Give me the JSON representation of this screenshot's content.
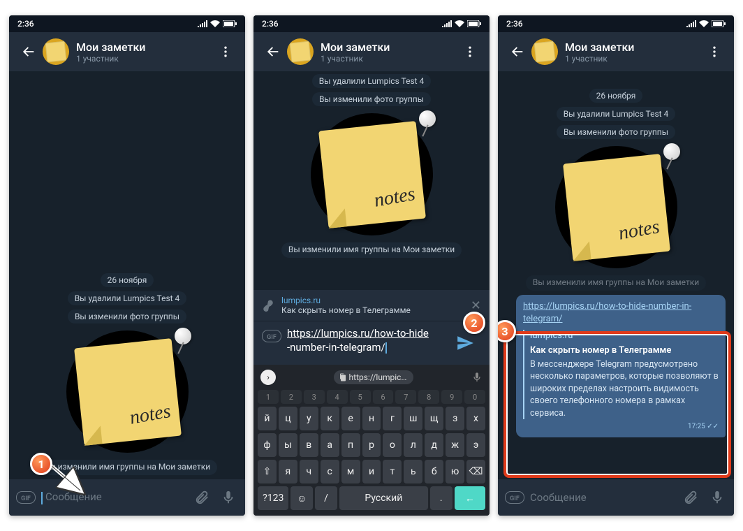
{
  "status": {
    "time": "2:36"
  },
  "chat": {
    "title": "Мои заметки",
    "subtitle": "1 участник",
    "date": "26 ноября",
    "sys1": "Вы удалили Lumpics Test 4",
    "sys2": "Вы изменили фото группы",
    "sys3": "Вы изменили имя группы на Мои заметки",
    "photo_label": "notes"
  },
  "input": {
    "placeholder": "Сообщение",
    "url_line1": "https://lumpics.ru/how-to-hide",
    "url_line2": "-number-in-telegram/"
  },
  "preview": {
    "site": "lumpics.ru",
    "title": "Как скрыть номер в Телеграмме"
  },
  "kb": {
    "sugg": "https://lumpic…",
    "num": [
      "1",
      "2",
      "3",
      "4",
      "5",
      "6",
      "7",
      "8",
      "9",
      "0"
    ],
    "r1": [
      "й",
      "ц",
      "у",
      "к",
      "е",
      "н",
      "г",
      "ш",
      "щ",
      "з",
      "х"
    ],
    "r2": [
      "ф",
      "ы",
      "в",
      "а",
      "п",
      "р",
      "о",
      "л",
      "д",
      "ж",
      "э"
    ],
    "r3": [
      "⇧",
      "я",
      "ч",
      "с",
      "м",
      "и",
      "т",
      "ь",
      "б",
      "ю",
      "⌫"
    ],
    "r4": {
      "sym": "?123",
      "emoji": "☺",
      "slash": "/",
      "lang": "Русский",
      "dot": ".",
      "enter": "←"
    }
  },
  "bubble": {
    "url": "https://lumpics.ru/how-to-hide-number-in-telegram/",
    "site": "lumpics.ru",
    "title": "Как скрыть номер в Телеграмме",
    "desc": "В мессенджере Telegram предусмотрено несколько параметров, которые позволяют в широких пределах настроить видимость своего телефонного номера в рамках сервиса.",
    "time": "17:25 ✓✓"
  },
  "badges": {
    "b1": "1",
    "b2": "2",
    "b3": "3"
  }
}
